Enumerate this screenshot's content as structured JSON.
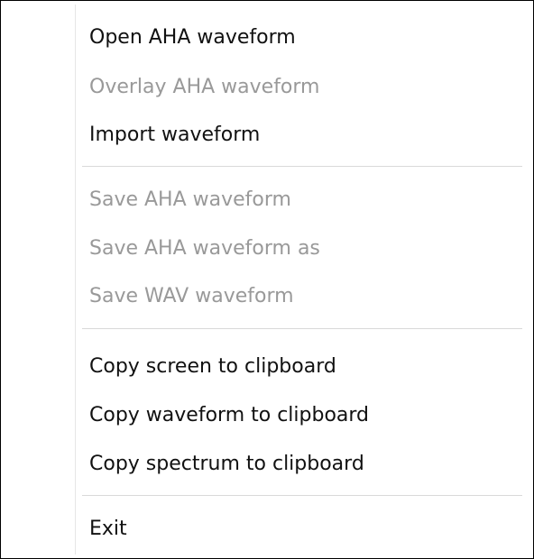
{
  "menu": {
    "items": [
      {
        "label": "Open AHA waveform",
        "enabled": true
      },
      {
        "label": "Overlay AHA waveform",
        "enabled": false
      },
      {
        "label": "Import waveform",
        "enabled": true
      },
      {
        "label": "Save AHA waveform",
        "enabled": false
      },
      {
        "label": "Save AHA waveform as",
        "enabled": false
      },
      {
        "label": "Save WAV waveform",
        "enabled": false
      },
      {
        "label": "Copy screen to clipboard",
        "enabled": true
      },
      {
        "label": "Copy waveform to clipboard",
        "enabled": true
      },
      {
        "label": "Copy spectrum to clipboard",
        "enabled": true
      },
      {
        "label": "Exit",
        "enabled": true
      }
    ]
  }
}
